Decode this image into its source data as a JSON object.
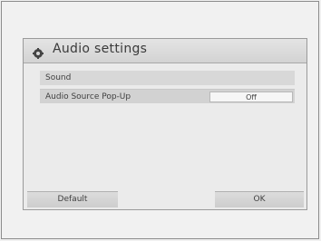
{
  "dialog": {
    "title": "Audio settings",
    "icon": "gear-icon"
  },
  "rows": [
    {
      "label": "Sound"
    },
    {
      "label": "Audio Source Pop-Up",
      "value": "Off"
    }
  ],
  "buttons": {
    "default_label": "Default",
    "ok_label": "OK"
  }
}
